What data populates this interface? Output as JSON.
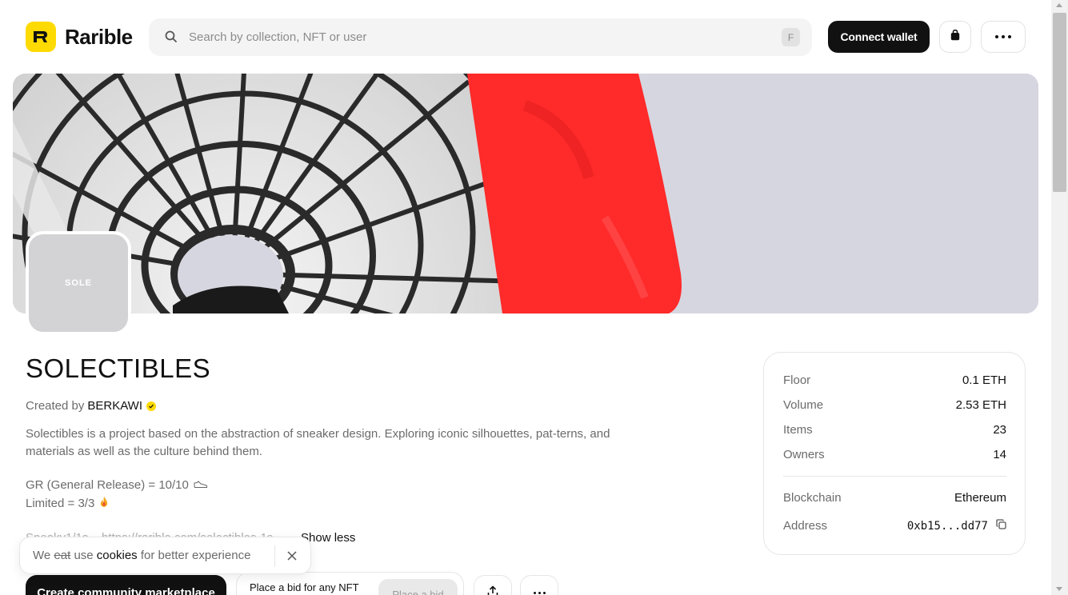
{
  "header": {
    "brand": "Rarible",
    "search_placeholder": "Search by collection, NFT or user",
    "search_shortcut": "F",
    "connect_wallet": "Connect wallet",
    "brand_color": "#FEDA03"
  },
  "banner": {
    "accent_color": "#FF2A2A",
    "background_color": "#D6D6E0"
  },
  "collection": {
    "avatar_text": "SOLE",
    "title": "SOLECTIBLES",
    "created_by_label": "Created by",
    "creator": "BERKAWI",
    "description": "Solectibles is a project based on the abstraction of sneaker design. Exploring iconic silhouettes, pat-terns, and materials as well as the culture behind them.",
    "line_gr": "GR (General Release) = 10/10",
    "line_limited": "Limited = 3/3",
    "link_faded": "Sneaky1/1s – https://rarible.com/solectibles-1s ,",
    "show_less": "Show less"
  },
  "stats": {
    "rows": [
      {
        "label": "Floor",
        "value": "0.1 ETH"
      },
      {
        "label": "Volume",
        "value": "2.53 ETH"
      },
      {
        "label": "Items",
        "value": "23"
      },
      {
        "label": "Owners",
        "value": "14"
      }
    ],
    "blockchain_label": "Blockchain",
    "blockchain_value": "Ethereum",
    "address_label": "Address",
    "address_value": "0xb15...dd77"
  },
  "cookie": {
    "prefix": "We",
    "struck": "eat",
    "middle": "use",
    "bold": "cookies",
    "suffix": "for better experience"
  },
  "actions": {
    "create_marketplace": "Create community marketplace",
    "bid_any": "Place a bid for any NFT",
    "place_bid": "Place a bid"
  },
  "icons": {
    "search": "search-icon",
    "cart": "bag-icon",
    "more": "more-icon",
    "verified": "verified-icon",
    "shoe": "sneaker-icon",
    "fire": "fire-icon",
    "copy": "copy-icon",
    "close": "close-icon",
    "share": "share-icon"
  }
}
